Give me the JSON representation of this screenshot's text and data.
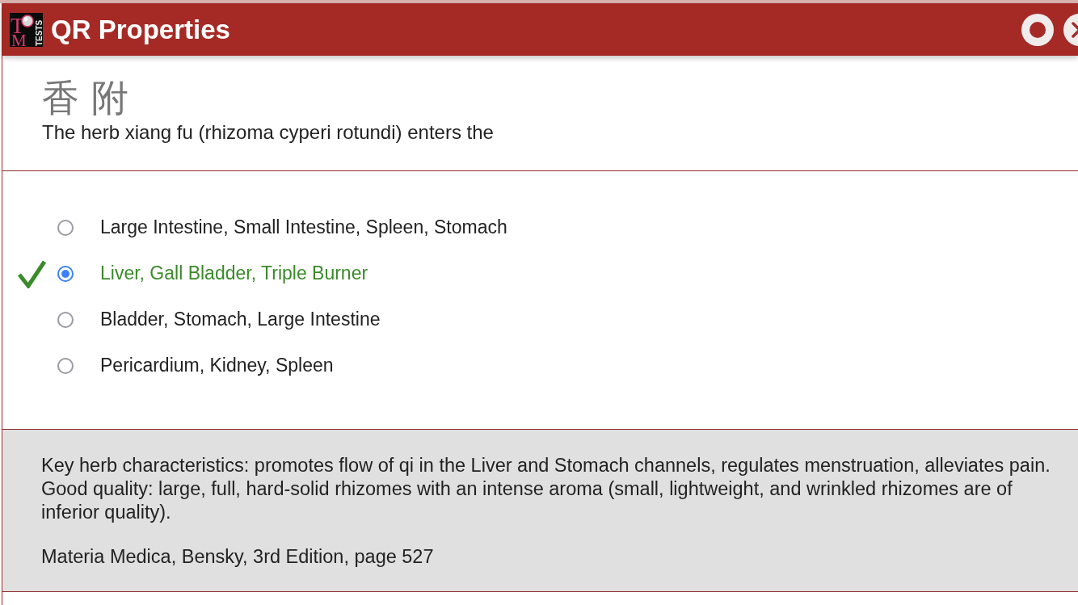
{
  "window": {
    "title": "QR Properties",
    "logo": {
      "letters": [
        "T",
        "M"
      ],
      "caption": "TESTS"
    },
    "buttons": [
      {
        "kind": "dot"
      },
      {
        "kind": "close"
      }
    ]
  },
  "question": {
    "herb_chinese": "香 附",
    "prompt": "The herb xiang fu (rhizoma cyperi rotundi) enters the"
  },
  "options": [
    {
      "label": "Large Intestine, Small Intestine, Spleen, Stomach",
      "selected": false,
      "correct": false
    },
    {
      "label": "Liver, Gall Bladder, Triple Burner",
      "selected": true,
      "correct": true
    },
    {
      "label": "Bladder, Stomach, Large Intestine",
      "selected": false,
      "correct": false
    },
    {
      "label": "Pericardium, Kidney, Spleen",
      "selected": false,
      "correct": false
    }
  ],
  "explanation": {
    "paragraphs": [
      "Key herb characteristics: promotes flow of qi in the Liver and Stomach channels, regulates menstruation, alleviates pain.",
      "Good quality: large, full, hard-solid rhizomes with an intense aroma (small, lightweight, and wrinkled rhizomes are of inferior quality)."
    ],
    "source": "Materia Medica, Bensky, 3rd Edition, page 527"
  }
}
